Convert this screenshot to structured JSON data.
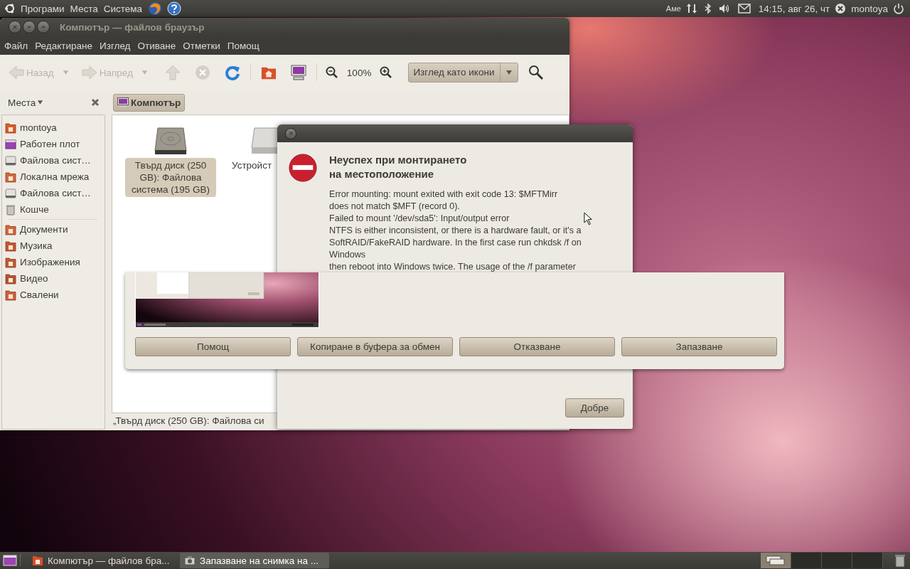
{
  "top_panel": {
    "menus": [
      "Програми",
      "Места",
      "Система"
    ],
    "keyboard": "Аме",
    "clock": "14:15, авг 26, чт",
    "user": "montoya"
  },
  "file_manager": {
    "title": "Компютър — файлов браузър",
    "menus": [
      "Файл",
      "Редактиране",
      "Изглед",
      "Отиване",
      "Отметки",
      "Помощ"
    ],
    "toolbar": {
      "back": {
        "label": "Назад",
        "disabled": true
      },
      "forward": {
        "label": "Напред",
        "disabled": true
      },
      "up": {
        "disabled": true
      },
      "stop": {
        "disabled": true
      },
      "zoom": "100%",
      "view": "Изглед като икони"
    },
    "sidebar": {
      "title": "Места",
      "groups": [
        [
          {
            "label": "montoya",
            "kind": "home"
          },
          {
            "label": "Работен плот",
            "kind": "desktop"
          },
          {
            "label": "Файлова сист…",
            "kind": "drive"
          },
          {
            "label": "Локална мрежа",
            "kind": "network"
          },
          {
            "label": "Файлова сист…",
            "kind": "drive"
          },
          {
            "label": "Кошче",
            "kind": "trash"
          }
        ],
        [
          {
            "label": "Документи",
            "kind": "documents"
          },
          {
            "label": "Музика",
            "kind": "music"
          },
          {
            "label": "Изображения",
            "kind": "pictures"
          },
          {
            "label": "Видео",
            "kind": "video"
          },
          {
            "label": "Свалени",
            "kind": "downloads"
          }
        ]
      ]
    },
    "location": "Компютър",
    "items": [
      {
        "label": "Твърд диск (250 GB): Файлова система (195 GB)",
        "kind": "drive",
        "selected": true
      },
      {
        "label": "Устройст",
        "kind": "optical",
        "selected": false
      }
    ],
    "status": "„Твърд диск (250 GB): Файлова си"
  },
  "error_dialog": {
    "title": "Неуспех при монтирането\nна местоположение",
    "message": "Error mounting: mount exited with exit code 13: $MFTMirr\ndoes not match $MFT (record 0).\nFailed to mount '/dev/sda5': Input/output error\nNTFS is either inconsistent, or there is a hardware fault, or it's a\nSoftRAID/FakeRAID hardware. In the first case run chkdsk /f on\nWindows\nthen reboot into Windows twice. The usage of the /f parameter",
    "button": "Добре"
  },
  "save_dialog": {
    "buttons": [
      "Помощ",
      "Копиране в буфера за обмен",
      "Отказване",
      "Запазване"
    ]
  },
  "taskbar": {
    "tasks": [
      {
        "label": "Компютър — файлов бра...",
        "selected": false
      },
      {
        "label": "Запазване на снимка на ...",
        "selected": true
      }
    ],
    "workspaces": [
      {
        "selected": true
      },
      {
        "selected": false
      },
      {
        "selected": false
      },
      {
        "selected": false
      }
    ]
  }
}
